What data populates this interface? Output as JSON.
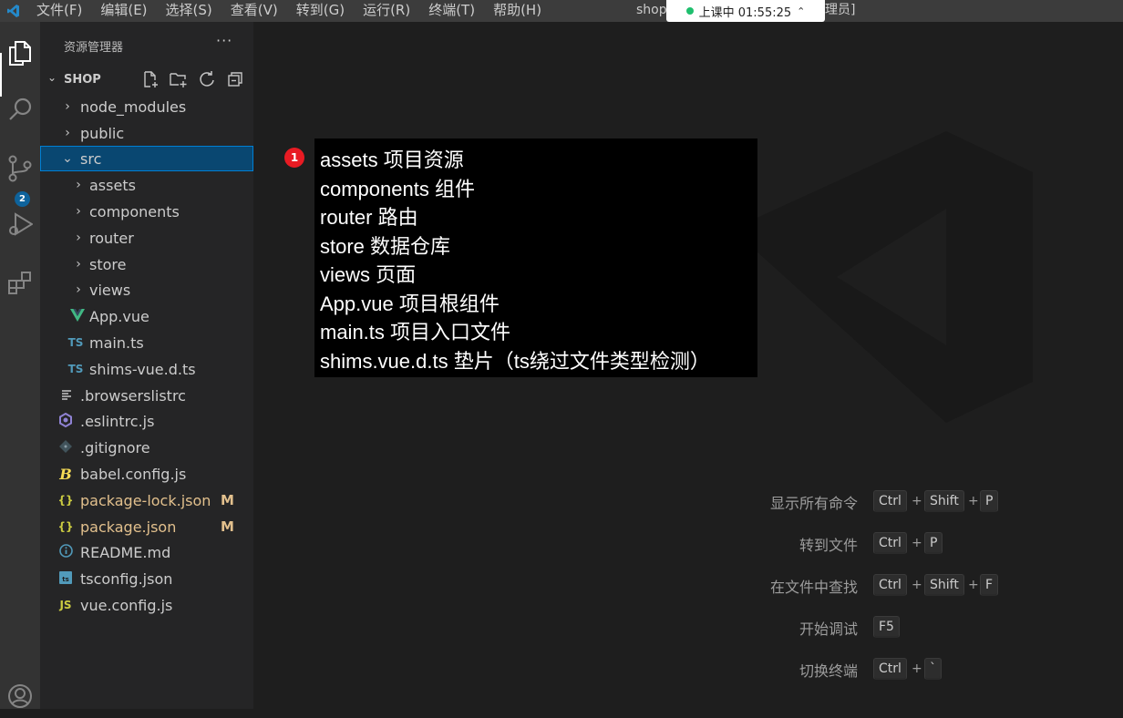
{
  "colors": {
    "accent": "#007acc",
    "selection": "#094771",
    "modified": "#e2c08d",
    "vue_green": "#41b883",
    "ts_blue": "#519aba",
    "js_yellow": "#cbcb41",
    "badge_red": "#e81b23"
  },
  "titlebar": {
    "menu": [
      "文件(F)",
      "编辑(E)",
      "选择(S)",
      "查看(V)",
      "转到(G)",
      "运行(R)",
      "终端(T)",
      "帮助(H)"
    ],
    "title_left": "shop",
    "title_right": "理员]",
    "live_status": "上课中 01:55:25"
  },
  "activity_bar": {
    "icons": [
      "explorer-icon",
      "search-icon",
      "source-control-icon",
      "run-debug-icon",
      "extensions-icon",
      "account-icon"
    ],
    "scm_badge": "2"
  },
  "sidebar": {
    "header": "资源管理器",
    "more": "···",
    "section_title": "SHOP",
    "items": [
      {
        "label": "node_modules",
        "type": "folder"
      },
      {
        "label": "public",
        "type": "folder"
      },
      {
        "label": "src",
        "type": "folder-open"
      },
      {
        "label": "assets",
        "type": "folder"
      },
      {
        "label": "components",
        "type": "folder"
      },
      {
        "label": "router",
        "type": "folder"
      },
      {
        "label": "store",
        "type": "folder"
      },
      {
        "label": "views",
        "type": "folder"
      },
      {
        "label": "App.vue",
        "type": "vue"
      },
      {
        "label": "main.ts",
        "type": "ts",
        "icon_text": "TS"
      },
      {
        "label": "shims-vue.d.ts",
        "type": "ts",
        "icon_text": "TS"
      },
      {
        "label": ".browserslistrc",
        "type": "config"
      },
      {
        "label": ".eslintrc.js",
        "type": "eslint"
      },
      {
        "label": ".gitignore",
        "type": "git"
      },
      {
        "label": "babel.config.js",
        "type": "babel"
      },
      {
        "label": "package-lock.json",
        "type": "json",
        "icon_text": "{}",
        "status": "M"
      },
      {
        "label": "package.json",
        "type": "json",
        "icon_text": "{}",
        "status": "M"
      },
      {
        "label": "README.md",
        "type": "info"
      },
      {
        "label": "tsconfig.json",
        "type": "tsconfig"
      },
      {
        "label": "vue.config.js",
        "type": "js",
        "icon_text": "JS"
      }
    ]
  },
  "annotation": {
    "badge": "1",
    "lines": [
      "assets 项目资源",
      "components 组件",
      "router 路由",
      "store 数据仓库",
      "views 页面",
      "App.vue 项目根组件",
      "main.ts 项目入口文件",
      "shims.vue.d.ts 垫片（ts绕过文件类型检测）"
    ]
  },
  "shortcuts": [
    {
      "label": "显示所有命令",
      "keys": [
        "Ctrl",
        "Shift",
        "P"
      ]
    },
    {
      "label": "转到文件",
      "keys": [
        "Ctrl",
        "P"
      ]
    },
    {
      "label": "在文件中查找",
      "keys": [
        "Ctrl",
        "Shift",
        "F"
      ]
    },
    {
      "label": "开始调试",
      "keys": [
        "F5"
      ]
    },
    {
      "label": "切换终端",
      "keys": [
        "Ctrl",
        "`"
      ]
    }
  ],
  "plus": "+"
}
